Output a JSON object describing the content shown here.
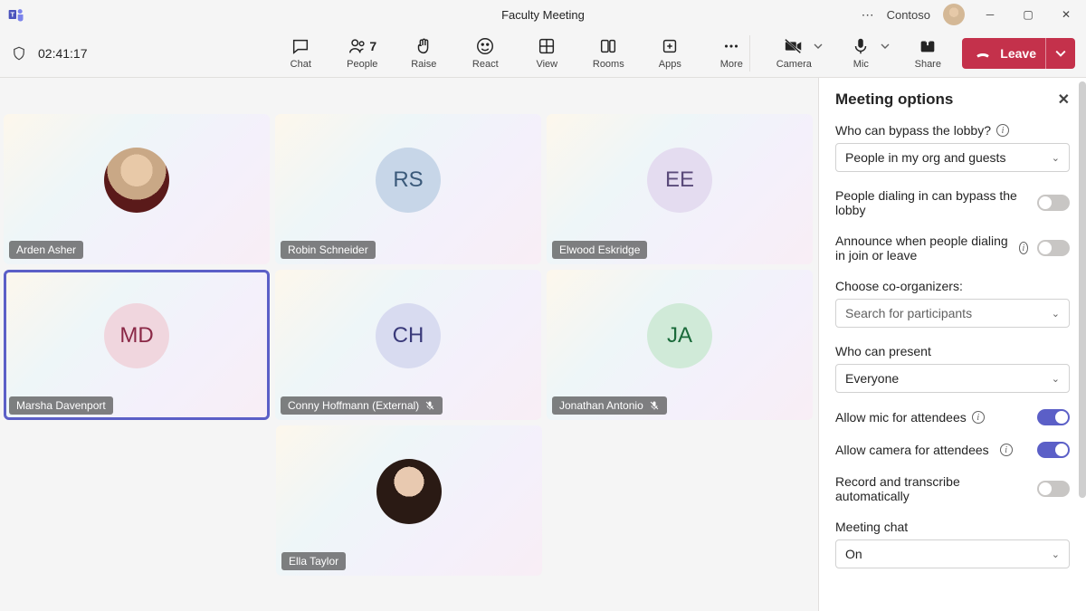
{
  "titlebar": {
    "title": "Faculty Meeting",
    "org": "Contoso"
  },
  "toolbar": {
    "timer": "02:41:17",
    "buttons": {
      "chat": "Chat",
      "people": "People",
      "people_count": "7",
      "raise": "Raise",
      "react": "React",
      "view": "View",
      "rooms": "Rooms",
      "apps": "Apps",
      "more": "More",
      "camera": "Camera",
      "mic": "Mic",
      "share": "Share"
    },
    "leave": "Leave"
  },
  "participants": [
    {
      "name": "Arden Asher",
      "initials": "",
      "photo": true,
      "muted": false,
      "speaking": false,
      "color": ""
    },
    {
      "name": "Robin Schneider",
      "initials": "RS",
      "photo": false,
      "muted": false,
      "speaking": false,
      "color": "c-rs"
    },
    {
      "name": "Elwood Eskridge",
      "initials": "EE",
      "photo": false,
      "muted": false,
      "speaking": false,
      "color": "c-ee"
    },
    {
      "name": "Marsha Davenport",
      "initials": "MD",
      "photo": false,
      "muted": false,
      "speaking": true,
      "color": "c-md"
    },
    {
      "name": "Conny Hoffmann (External)",
      "initials": "CH",
      "photo": false,
      "muted": true,
      "speaking": false,
      "color": "c-ch"
    },
    {
      "name": "Jonathan Antonio",
      "initials": "JA",
      "photo": false,
      "muted": true,
      "speaking": false,
      "color": "c-ja"
    },
    {
      "name": "Ella Taylor",
      "initials": "",
      "photo": true,
      "muted": false,
      "speaking": false,
      "color": ""
    }
  ],
  "panel": {
    "title": "Meeting options",
    "bypass_label": "Who can bypass the lobby?",
    "bypass_value": "People in my org and guests",
    "dialin_bypass_label": "People dialing in can bypass the lobby",
    "dialin_bypass": false,
    "announce_label": "Announce when people dialing in join or leave",
    "announce": false,
    "coorg_label": "Choose co-organizers:",
    "coorg_placeholder": "Search for participants",
    "present_label": "Who can present",
    "present_value": "Everyone",
    "allow_mic_label": "Allow mic for attendees",
    "allow_mic": true,
    "allow_cam_label": "Allow camera for attendees",
    "allow_cam": true,
    "record_label": "Record and transcribe automatically",
    "record": false,
    "chat_label": "Meeting chat",
    "chat_value": "On"
  }
}
